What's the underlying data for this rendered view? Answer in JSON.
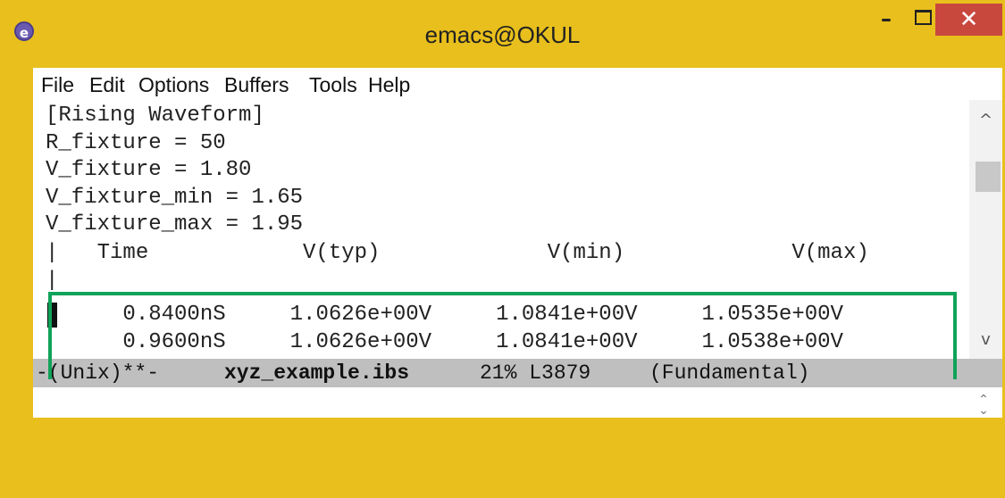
{
  "window": {
    "title": "emacs@OKUL",
    "icon": "emacs-icon",
    "controls": {
      "minimize": "–",
      "maximize": "maximize-icon",
      "close": "✕"
    }
  },
  "menu": [
    "File",
    "Edit",
    "Options",
    "Buffers",
    "Tools",
    "Help"
  ],
  "buffer_lines": [
    "[Rising Waveform]",
    "R_fixture = 50",
    "V_fixture = 1.80",
    "V_fixture_min = 1.65",
    "V_fixture_max = 1.95",
    "|   Time            V(typ)             V(min)             V(max)",
    "|",
    "      0.8400nS     1.0626e+00V     1.0841e+00V     1.0535e+00V",
    "      0.9600nS     1.0626e+00V     1.0841e+00V     1.0538e+00V"
  ],
  "modeline": {
    "status": "-(Unix)**-",
    "filename": "xyz_example.ibs",
    "position": "21% L3879",
    "mode": "(Fundamental)"
  },
  "scrollbar": {
    "up": "^",
    "down": "v"
  },
  "colors": {
    "frame": "#e8bf1c",
    "close": "#c9483e",
    "highlight": "#10a35a",
    "modeline": "#bfbfbf"
  }
}
